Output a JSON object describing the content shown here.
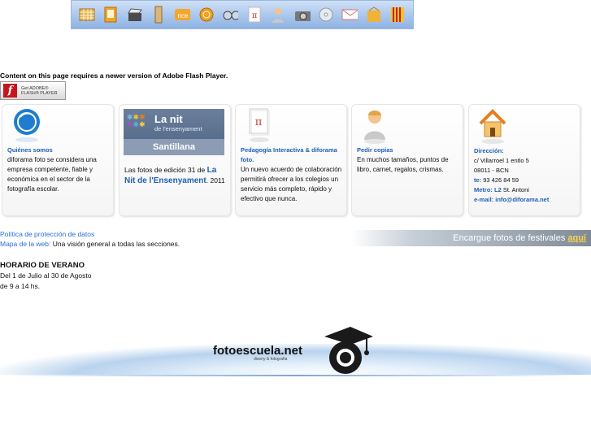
{
  "toolbar": {
    "icons": [
      "grid-icon",
      "book-icon",
      "clapper-icon",
      "tall-book-icon",
      "nce-icon",
      "coin-icon",
      "spectacles-icon",
      "pi-icon",
      "person-icon",
      "camera-icon",
      "cd-icon",
      "mail-icon",
      "folder-icon",
      "catalan-flag-icon"
    ]
  },
  "flash": {
    "message": "Content on this page requires a newer version of Adobe Flash Player.",
    "button_line1": "Get ADOBE®",
    "button_line2": "FLASH® PLAYER"
  },
  "boxes": {
    "quienes": {
      "title": "Quiénes somos",
      "text": "diforama foto se considera una empresa competente, fiable y económica en el sector de la fotografía escolar."
    },
    "nit": {
      "image_title": "La nit",
      "image_subtitle": "de l'ensenyament",
      "image_brand": "Santillana",
      "text_before": "Las fotos de edición 31 de ",
      "link": "La Nit de l'Ensenyament",
      "text_after": ". 2011"
    },
    "pedagogia": {
      "title": "Pedagogía Interactiva & diforama foto.",
      "text": "Un nuevo acuerdo de colaboración permitirá ofrecer a los colegios un servicio más completo, rápido y efectivo que nunca."
    },
    "pedir": {
      "title": "Pedir copias",
      "text": "En muchos tamaños, puntos de libro, carnet, regalos, crismas."
    },
    "direccion": {
      "title": "Dirección:",
      "street": "c/ Villarroel 1 entlo 5",
      "city": "08011 - BCN",
      "tel_label": "te:",
      "tel": " 93 426 84 59",
      "metro_label": "Metro: L2",
      "metro": " St. Antoni",
      "email": "e-mail: info@diforama.net"
    }
  },
  "links": {
    "privacy": "Política de protección de datos",
    "sitemap": "Mapa de la web:",
    "sitemap_desc": " Una visión general a todas las secciones."
  },
  "banner": {
    "text": "Encargue fotos de festivales ",
    "link": "aquí"
  },
  "horario": {
    "title": "HORARIO DE VERANO",
    "line1": "Del 1 de Julio al 30 de Agosto",
    "line2": "de 9 a 14 hs."
  },
  "footer": {
    "brand": "fotoescuela.net",
    "tagline": "diseny & fotografia"
  }
}
